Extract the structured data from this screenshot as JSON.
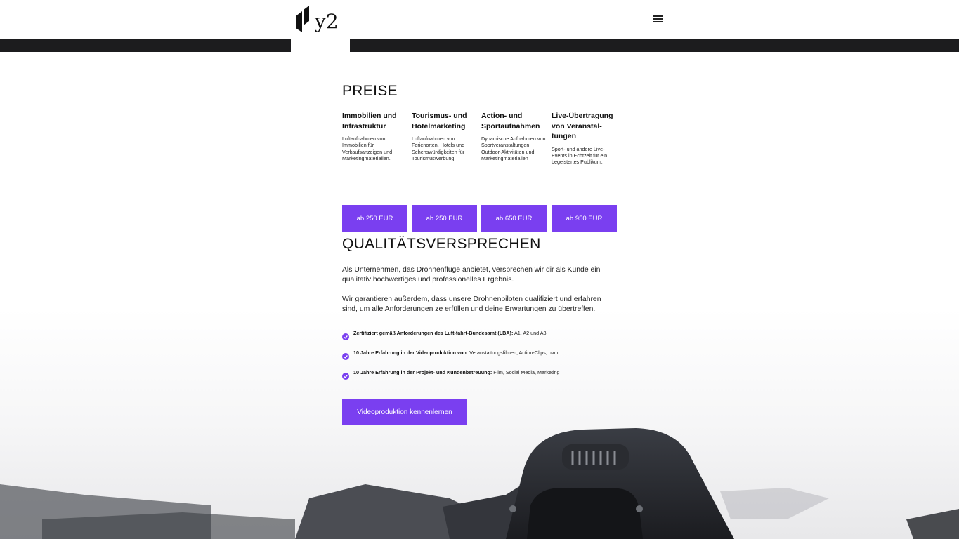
{
  "header": {
    "logo_text": "y2",
    "menu_icon": "hamburger-menu-icon"
  },
  "pricing": {
    "heading": "PREISE",
    "items": [
      {
        "title": "Immobilien und Infrastruktur",
        "description": "Luftaufnahmen von Immobilien für Verkaufsanzeigen und Marketingmaterialien.",
        "price": "ab 250 EUR"
      },
      {
        "title": "Tourismus- und Hotelmarketing",
        "description": "Luftaufnahmen von Ferienorten, Hotels und Sehenswürdigkeiten für Tourismuswerbung.",
        "price": "ab 250 EUR"
      },
      {
        "title": "Action- und Sportaufnahmen",
        "description": "Dynamische Aufnahmen von Sportveranstaltungen, Outdoor-Aktivitäten und Marketingmaterialien",
        "price": "ab 650 EUR"
      },
      {
        "title": "Live-Übertragung von Veranstal-tungen",
        "description": "Sport- und andere Live-Events in Echtzeit für ein begeistertes Publikum.",
        "price": "ab 950 EUR"
      }
    ]
  },
  "quality": {
    "heading": "QUALITÄTSVERSPRECHEN",
    "paragraph_1": "Als Unternehmen, das Drohnenflüge anbietet, versprechen wir dir als Kunde ein qualitativ hochwertiges und professionelles Ergebnis.",
    "paragraph_2": "Wir garantieren außerdem, dass unsere Drohnenpiloten qualifiziert und erfahren sind, um alle Anforderungen ze erfüllen und deine Erwartungen zu übertreffen.",
    "checks": [
      {
        "bold": "Zertifiziert gemäß Anforderungen des Luft-fahrt-Bundesamt (LBA):",
        "normal": " A1, A2 und A3"
      },
      {
        "bold": "10 Jahre Erfahrung in der Videoproduktion von:",
        "normal": " Veranstaltungsfilmen, Action-Clips, uvm."
      },
      {
        "bold": "10 Jahre Erfahrung in der Projekt- und Kundenbetreuung:",
        "normal": " Film, Social Media, Marketing"
      }
    ],
    "cta_label": "Videoproduktion kennenlernen"
  },
  "colors": {
    "accent": "#7a3ff0",
    "band": "#1c1c1e",
    "text": "#111111"
  }
}
